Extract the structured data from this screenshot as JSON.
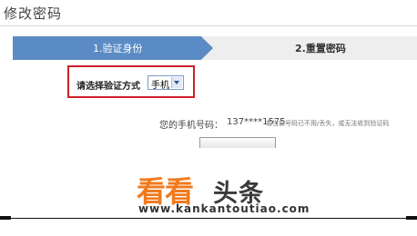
{
  "page": {
    "title": "修改密码"
  },
  "steps": [
    {
      "label": "1.验证身份",
      "active": true
    },
    {
      "label": "2.重置密码",
      "active": false
    }
  ],
  "verify_method": {
    "label": "请选择验证方式",
    "selected": "手机"
  },
  "phone": {
    "label": "您的手机号码：",
    "value": "137****1575",
    "note": "若当前号码已不用/丢失，或无法收到验证码"
  },
  "watermark": {
    "brand_kan": "看看",
    "brand_toutiao": "头条",
    "url": "www.kankantoutiao.com"
  },
  "colors": {
    "step_active": "#5b8bc4",
    "highlight_border": "#d0202a",
    "watermark_orange": "#f07a1e"
  }
}
